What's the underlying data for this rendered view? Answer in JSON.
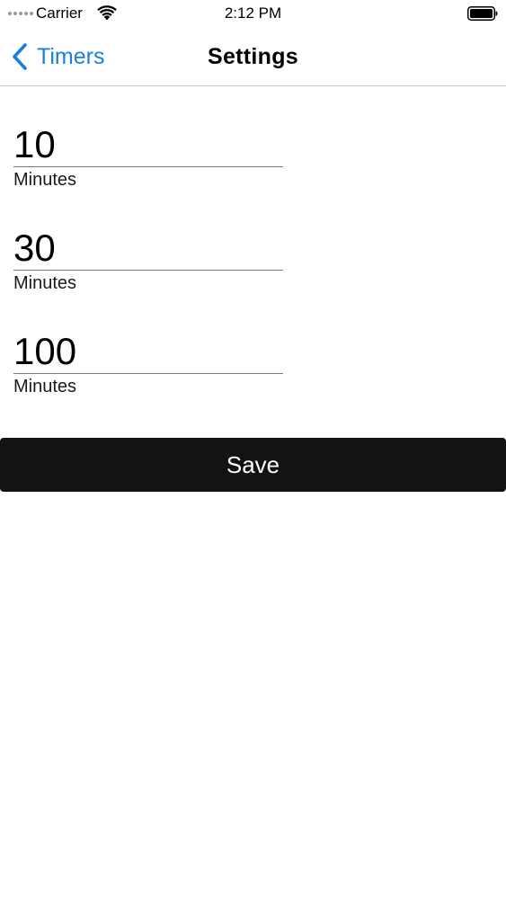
{
  "status_bar": {
    "carrier": "Carrier",
    "time": "2:12 PM",
    "icons": [
      "signal-dots-icon",
      "wifi-icon",
      "battery-icon"
    ]
  },
  "nav_bar": {
    "back_label": "Timers",
    "title": "Settings",
    "accent_color": "#1a7fe0"
  },
  "fields": [
    {
      "value": "10",
      "unit": "Minutes"
    },
    {
      "value": "30",
      "unit": "Minutes"
    },
    {
      "value": "100",
      "unit": "Minutes"
    }
  ],
  "save_button": {
    "label": "Save",
    "background": "#141311"
  }
}
